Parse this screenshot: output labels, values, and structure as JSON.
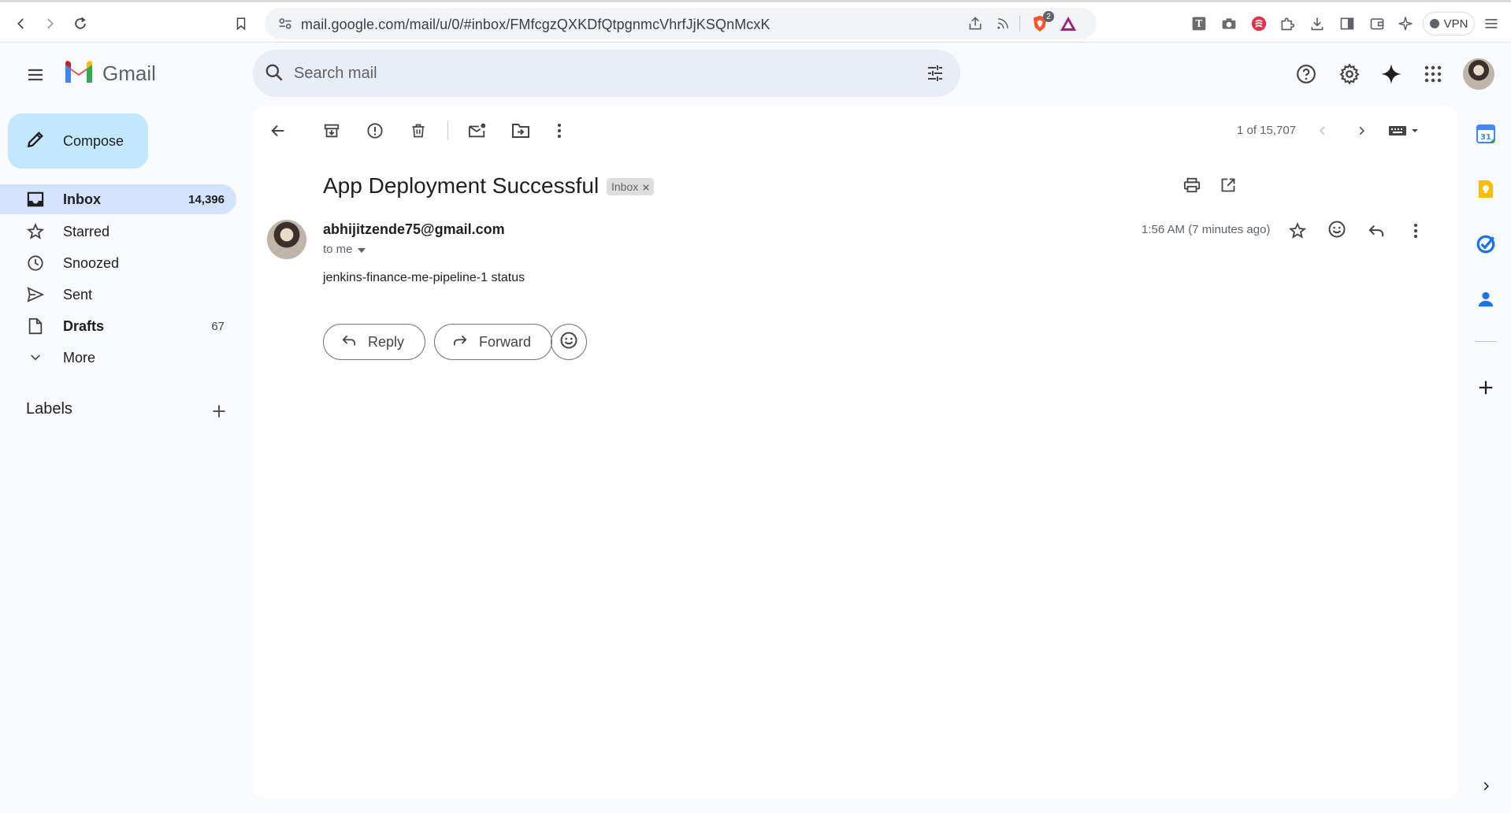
{
  "browser": {
    "url": "mail.google.com/mail/u/0/#inbox/FMfcgzQXKDfQtpgnmcVhrfJjKSQnMcxK",
    "brave_badge": "2",
    "vpn_label": "VPN"
  },
  "gmail": {
    "logo_text": "Gmail",
    "search_placeholder": "Search mail"
  },
  "sidebar": {
    "compose_label": "Compose",
    "items": [
      {
        "label": "Inbox",
        "count": "14,396"
      },
      {
        "label": "Starred",
        "count": ""
      },
      {
        "label": "Snoozed",
        "count": ""
      },
      {
        "label": "Sent",
        "count": ""
      },
      {
        "label": "Drafts",
        "count": "67"
      },
      {
        "label": "More",
        "count": ""
      }
    ],
    "labels_title": "Labels"
  },
  "toolbar": {
    "pager": "1 of 15,707"
  },
  "message": {
    "subject": "App Deployment Successful",
    "label_chip": "Inbox",
    "sender": "abhijitzende75@gmail.com",
    "recipient": "to me",
    "timestamp": "1:56 AM (7 minutes ago)",
    "body": "jenkins-finance-me-pipeline-1 status",
    "reply_label": "Reply",
    "forward_label": "Forward"
  },
  "colors": {
    "compose_bg": "#c2e7ff",
    "active_nav": "#d3e3fd",
    "search_bg": "#e9eef6"
  }
}
